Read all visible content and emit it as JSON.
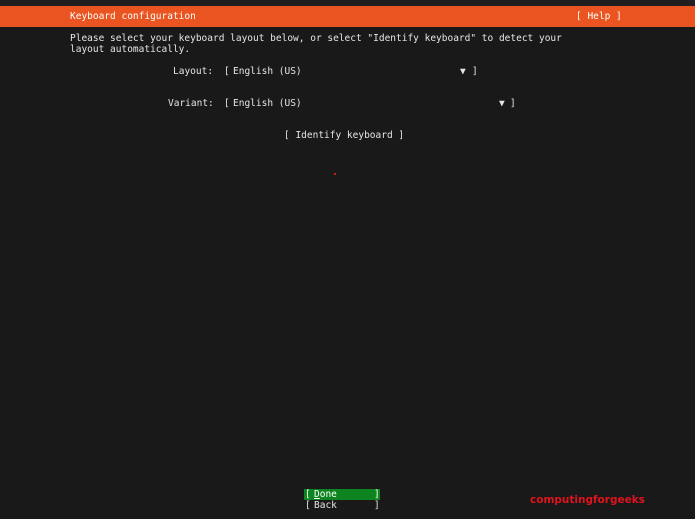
{
  "header": {
    "title": "Keyboard configuration",
    "help_label": "[ Help ]",
    "accent_color": "#e95420"
  },
  "instructions": "Please select your keyboard layout below, or select \"Identify keyboard\" to detect your layout automatically.",
  "form": {
    "layout": {
      "label": "Layout:",
      "open_bracket": "[",
      "value": "English (US)",
      "arrow": "▼",
      "close_bracket": "]"
    },
    "variant": {
      "label": "Variant:",
      "open_bracket": "[",
      "value": "English (US)",
      "arrow": "▼",
      "close_bracket": "]"
    },
    "identify_label": "[ Identify keyboard ]"
  },
  "footer": {
    "done": {
      "open_bracket": "[",
      "label": "Done",
      "close_bracket": "]",
      "selected_color": "#0e8420"
    },
    "back": {
      "open_bracket": "[",
      "label": "Back",
      "close_bracket": "]"
    }
  },
  "watermark": "computingforgeeks"
}
